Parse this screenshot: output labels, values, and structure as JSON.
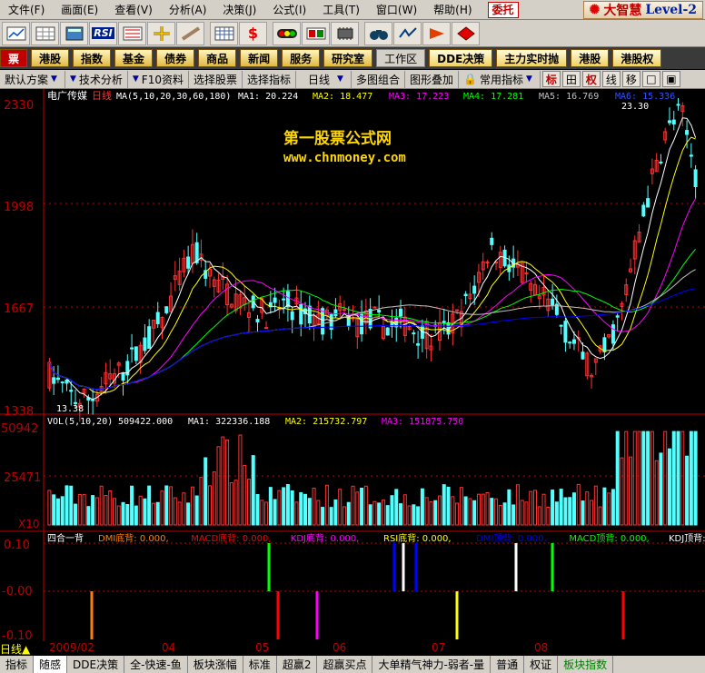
{
  "menu": {
    "items": [
      "文件(F)",
      "画面(E)",
      "查看(V)",
      "分析(A)",
      "决策(J)",
      "公式(I)",
      "工具(T)",
      "窗口(W)",
      "帮助(H)"
    ],
    "weituo": "委托",
    "logo": "大智慧",
    "level": "Level-2"
  },
  "toolbar_icons": [
    "chart-icon",
    "grid-icon",
    "calc-icon",
    "rsi-icon",
    "market-icon",
    "crosshair-icon",
    "ruler-icon",
    "grid2-icon",
    "dollar-icon",
    "traffic-icon",
    "flag-icon",
    "chip-icon",
    "binoculars-icon",
    "ddx-icon",
    "news-icon",
    "diamond-icon"
  ],
  "toolbar_texts": {
    "rsi": "RSI"
  },
  "nav": [
    "票",
    "港股",
    "指数",
    "基金",
    "债券",
    "商品",
    "新闻",
    "服务",
    "研究室",
    "工作区",
    "DDE决策",
    "主力实时抛",
    "港股",
    "港股权"
  ],
  "tabs": [
    "默认方案",
    "技术分析",
    "F10资料",
    "选择股票",
    "选择指标",
    "日线",
    "多图组合",
    "图形叠加",
    "常用指标"
  ],
  "tab_buttons": [
    "标",
    "田",
    "权",
    "线",
    "移",
    "□",
    "▣"
  ],
  "price_panel": {
    "stock": "电广传媒",
    "period": "日线",
    "ma_label": "MA(5,10,20,30,60,180)",
    "ma1": "MA1: 20.224",
    "ma2": "MA2: 18.477",
    "ma3": "MA3: 17.223",
    "ma4": "MA4: 17.281",
    "ma5": "MA5: 16.769",
    "ma6": "MA6: 15.336",
    "y_labels": [
      "2330",
      "1998",
      "1667",
      "1338"
    ],
    "high_label": "23.30",
    "low_label": "13.38",
    "watermark_title": "第一股票公式网",
    "watermark_url": "www.chnmoney.com"
  },
  "vol_panel": {
    "label": "VOL(5,10,20)",
    "vol": "509422.000",
    "ma1": "MA1: 322336.188",
    "ma2": "MA2: 215732.797",
    "ma3": "MA3: 151875.750",
    "y_labels": [
      "50942",
      "25471",
      "X10"
    ]
  },
  "ind_panel": {
    "name": "四合一背",
    "items": [
      {
        "text": "DMI底背: 0.000,",
        "color": "#ff8000"
      },
      {
        "text": "MACD底背: 0.000,",
        "color": "#ff0000"
      },
      {
        "text": "KDJ底背: 0.000,",
        "color": "#ff00ff"
      },
      {
        "text": "RSI底背: 0.000,",
        "color": "#ffff00"
      },
      {
        "text": "DMI顶背: 0.000,",
        "color": "#0000ff"
      },
      {
        "text": "MACD顶背: 0.000,",
        "color": "#00ff00"
      },
      {
        "text": "KDJ顶背: 0.000,",
        "color": "#ffffff"
      }
    ],
    "y_labels": [
      "0.10",
      "-0.00",
      "-0.10"
    ]
  },
  "dates": [
    "2009/02",
    "04",
    "05",
    "06",
    "07",
    "08"
  ],
  "period_label": "日线",
  "bottom_tabs": [
    "指标",
    "随感",
    "DDE决策",
    "全-快速-鱼",
    "板块涨幅",
    "标准",
    "超赢2",
    "超赢买点",
    "大单精气神力-弱者-量",
    "普通",
    "权证",
    "板块指数"
  ],
  "colors": {
    "up": "#ff3232",
    "down": "#54ffff",
    "ma1": "#ffffff",
    "ma2": "#ffff00",
    "ma3": "#ff00ff",
    "ma4": "#00ff00",
    "ma5": "#c0c0c0",
    "ma6": "#0000ff",
    "axis": "#c00000"
  }
}
